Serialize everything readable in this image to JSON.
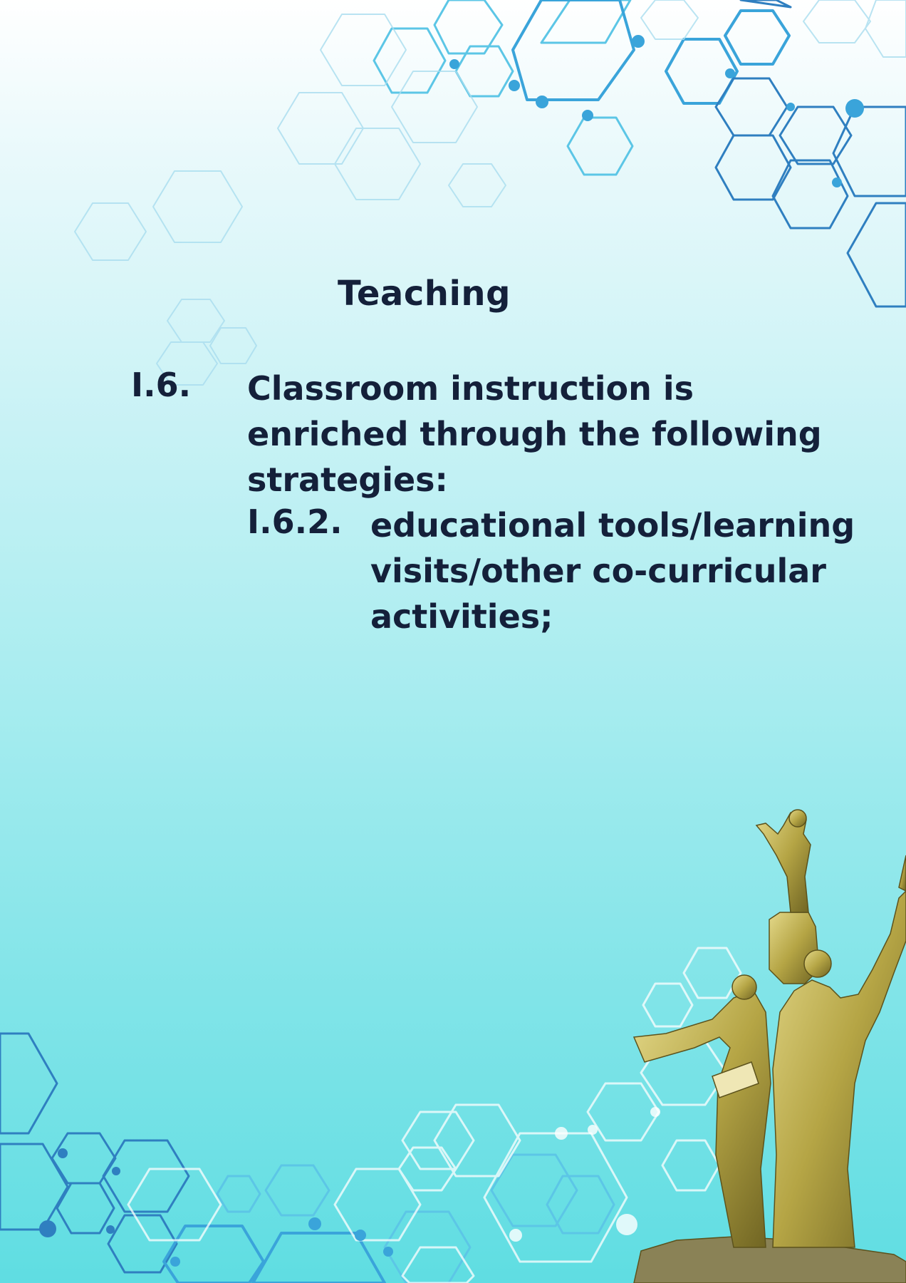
{
  "page": {
    "heading": "Teaching",
    "item": {
      "number": "I.6.",
      "lines": [
        "Classroom instruction is",
        "enriched through the following",
        "strategies:"
      ]
    },
    "subitem": {
      "number": "I.6.2.",
      "lines": [
        "educational tools/learning",
        "visits/other co-curricular",
        "activities;"
      ]
    }
  },
  "colors": {
    "text": "#14203a",
    "hex_dark": "#2f7fc0",
    "hex_light": "#5cc6e6",
    "statue": "#b5a545"
  }
}
